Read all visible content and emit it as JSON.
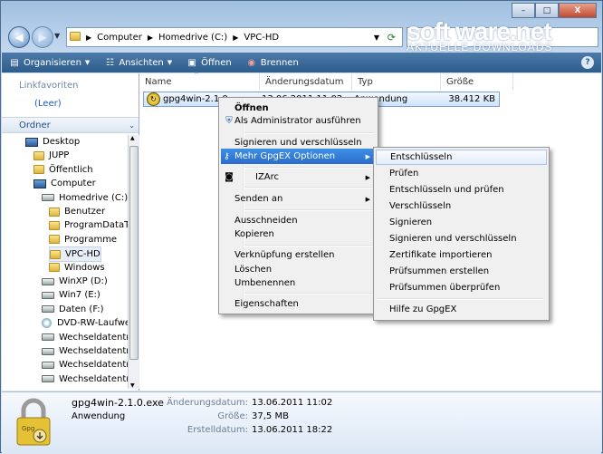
{
  "window": {
    "buttons": {
      "minimize": "–",
      "maximize": "□",
      "close": "X"
    }
  },
  "address": {
    "segments": [
      "Computer",
      "Homedrive (C:)",
      "VPC-HD"
    ]
  },
  "watermark": {
    "main": "soft ware.net",
    "sub": "AKTUELLE DOWNLOADS"
  },
  "toolbar": {
    "organize": "Organisieren",
    "views": "Ansichten",
    "open": "Öffnen",
    "burn": "Brennen",
    "help": "?"
  },
  "sidebar": {
    "favorites_header": "Linkfavoriten",
    "empty": "(Leer)",
    "folders_header": "Ordner",
    "tree": [
      {
        "label": "Desktop",
        "icon": "desktop-icon"
      },
      {
        "label": "JUPP",
        "icon": "folder-icon"
      },
      {
        "label": "Öffentlich",
        "icon": "folder-icon"
      },
      {
        "label": "Computer",
        "icon": "computer-icon"
      },
      {
        "label": "Homedrive (C:)",
        "icon": "drive-icon"
      },
      {
        "label": "Benutzer",
        "icon": "folder-icon"
      },
      {
        "label": "ProgramDataTe",
        "icon": "folder-icon"
      },
      {
        "label": "Programme",
        "icon": "folder-icon"
      },
      {
        "label": "VPC-HD",
        "icon": "folder-icon"
      },
      {
        "label": "Windows",
        "icon": "folder-icon"
      },
      {
        "label": "WinXP (D:)",
        "icon": "drive-icon"
      },
      {
        "label": "Win7 (E:)",
        "icon": "drive-icon"
      },
      {
        "label": "Daten (F:)",
        "icon": "drive-icon"
      },
      {
        "label": "DVD-RW-Laufwer",
        "icon": "dvd-icon"
      },
      {
        "label": "Wechseldatenträg",
        "icon": "removable-drive-icon"
      },
      {
        "label": "Wechseldatenträg",
        "icon": "removable-drive-icon"
      },
      {
        "label": "Wechseldatenträg",
        "icon": "removable-drive-icon"
      },
      {
        "label": "Wechseldatenträg",
        "icon": "removable-drive-icon"
      }
    ]
  },
  "columns": {
    "name": "Name",
    "date": "Änderungsdatum",
    "type": "Typ",
    "size": "Größe"
  },
  "file": {
    "name": "gpg4win-2.1.0",
    "date": "13.06.2011 11:02",
    "type": "Anwendung",
    "size": "38.412 KB"
  },
  "context_menu": {
    "open": "Öffnen",
    "run_as_admin": "Als Administrator ausführen",
    "sign_encrypt": "Signieren und verschlüsseln",
    "more_gpgex": "Mehr GpgEX Optionen",
    "izarc": "IZArc",
    "send_to": "Senden an",
    "cut": "Ausschneiden",
    "copy": "Kopieren",
    "create_shortcut": "Verknüpfung erstellen",
    "delete": "Löschen",
    "rename": "Umbenennen",
    "properties": "Eigenschaften"
  },
  "submenu": {
    "items": [
      "Entschlüsseln",
      "Prüfen",
      "Entschlüsseln und prüfen",
      "Verschlüsseln",
      "Signieren",
      "Signieren und verschlüsseln",
      "Zertifikate importieren",
      "Prüfsummen erstellen",
      "Prüfsummen überprüfen"
    ],
    "help": "Hilfe zu GpgEX"
  },
  "details": {
    "filename": "gpg4win-2.1.0.exe",
    "filetype": "Anwendung",
    "modified_label": "Änderungsdatum:",
    "modified_value": "13.06.2011 11:02",
    "size_label": "Größe:",
    "size_value": "37,5 MB",
    "created_label": "Erstelldatum:",
    "created_value": "13.06.2011 18:22"
  }
}
